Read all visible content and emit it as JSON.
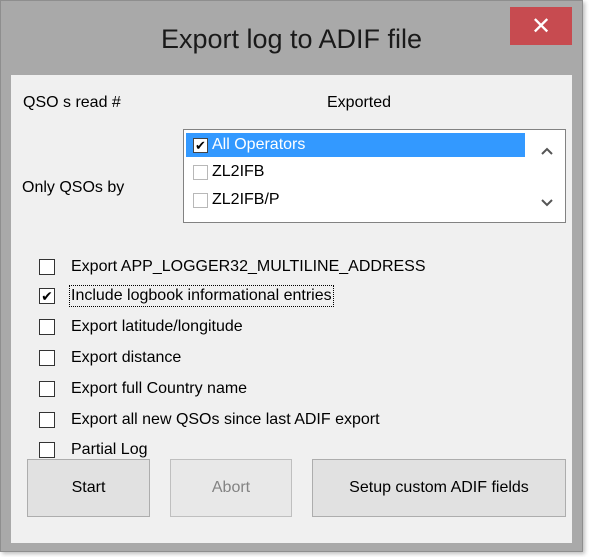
{
  "window": {
    "title": "Export log to ADIF file",
    "close_symbol": "✕"
  },
  "labels": {
    "qso_read": "QSO s read #",
    "exported": "Exported",
    "only_qsos_by": "Only QSOs by"
  },
  "operators": [
    {
      "label": "All Operators",
      "checked": true,
      "selected": true
    },
    {
      "label": "ZL2IFB",
      "checked": false,
      "selected": false
    },
    {
      "label": "ZL2IFB/P",
      "checked": false,
      "selected": false
    }
  ],
  "options": [
    {
      "label": "Export APP_LOGGER32_MULTILINE_ADDRESS",
      "checked": false
    },
    {
      "label": "Include logbook informational entries",
      "checked": true
    },
    {
      "label": "Export latitude/longitude",
      "checked": false
    },
    {
      "label": "Export distance",
      "checked": false
    },
    {
      "label": "Export full Country name",
      "checked": false
    },
    {
      "label": "Export all new QSOs since last ADIF export",
      "checked": false
    },
    {
      "label": "Partial Log",
      "checked": false
    }
  ],
  "buttons": {
    "start": "Start",
    "abort": "Abort",
    "setup": "Setup custom ADIF fields"
  },
  "icons": {
    "close": "close-icon",
    "scroll_up": "chevron-up-icon",
    "scroll_down": "chevron-down-icon",
    "check": "checkmark-icon"
  },
  "colors": {
    "close_button": "#c74b50",
    "selection": "#3399ff",
    "frame": "#a9a9a9",
    "client": "#f0f0f0"
  }
}
